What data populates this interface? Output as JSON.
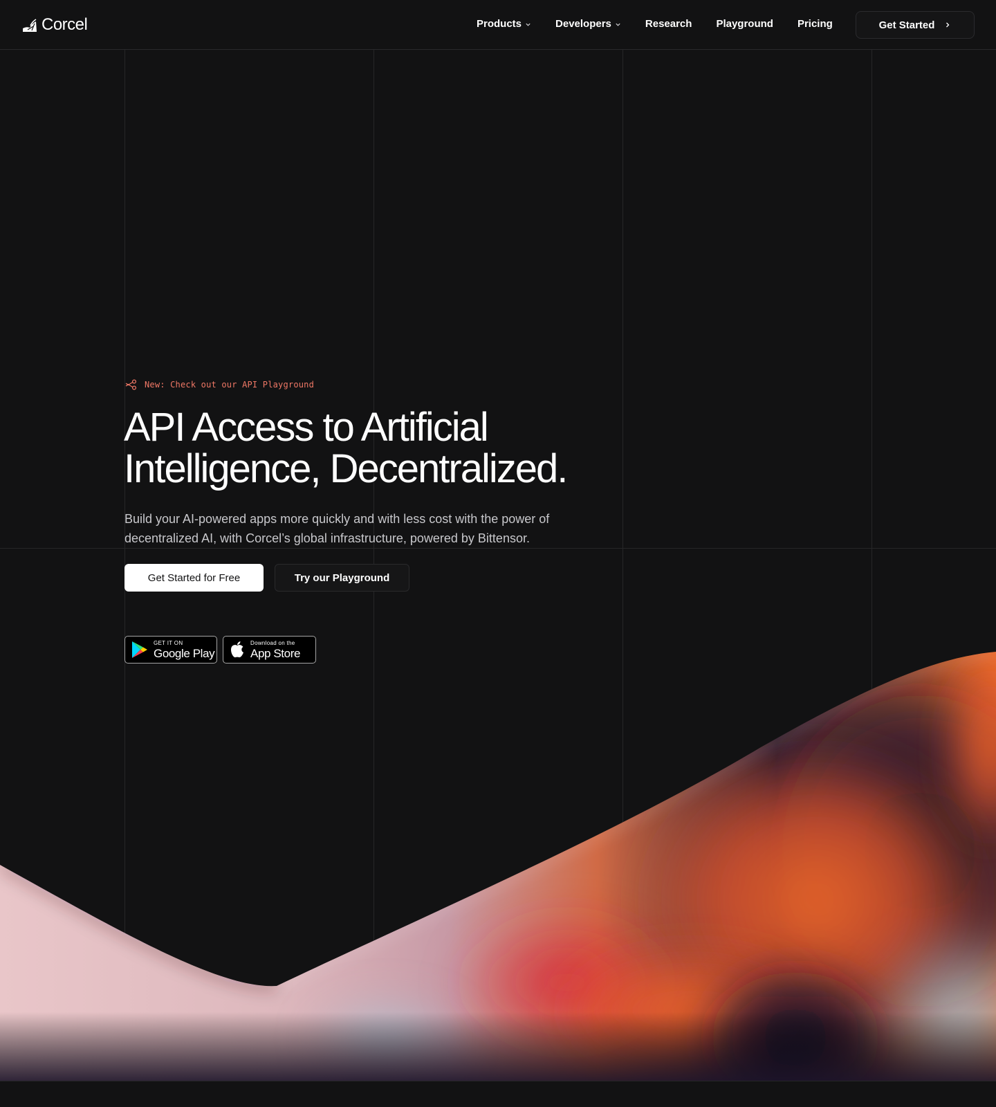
{
  "brand": {
    "name": "Corcel",
    "logo_icon": "corcel-logo-icon"
  },
  "nav": {
    "items": [
      {
        "label": "Products",
        "has_dropdown": true
      },
      {
        "label": "Developers",
        "has_dropdown": true
      },
      {
        "label": "Research",
        "has_dropdown": false
      },
      {
        "label": "Playground",
        "has_dropdown": false
      },
      {
        "label": "Pricing",
        "has_dropdown": false
      }
    ],
    "cta_label": "Get Started"
  },
  "hero": {
    "announcement": "New: Check out our API Playground",
    "announcement_icon": "share-nodes-icon",
    "title_line1": "API Access to Artificial",
    "title_line2": "Intelligence, Decentralized.",
    "subtitle": "Build your AI-powered apps more quickly and with less cost with the power of decentralized AI, with Corcel’s global infrastructure, powered by Bittensor.",
    "primary_button": "Get Started for Free",
    "secondary_button": "Try our Playground"
  },
  "stores": {
    "google_play": {
      "small": "GET IT ON",
      "large": "Google Play"
    },
    "app_store": {
      "small": "Download on the",
      "large": "App Store"
    }
  },
  "colors": {
    "background": "#121213",
    "accent": "#f07866",
    "primary_button_bg": "#ffffff",
    "wave_orange": "#ec6a2c",
    "wave_pink": "#e9c9cc"
  }
}
